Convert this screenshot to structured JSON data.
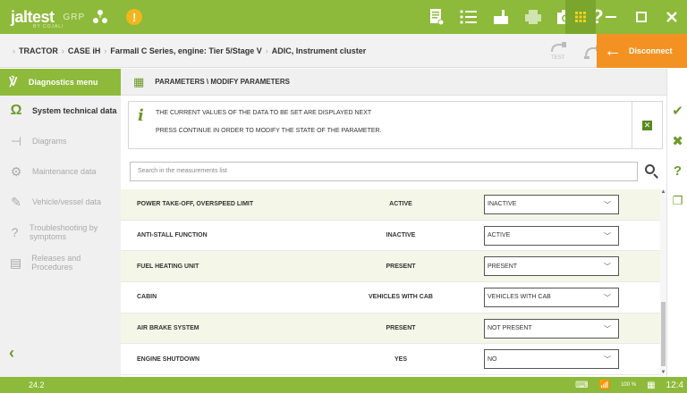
{
  "header": {
    "brand": "jaltest",
    "group": "GRP",
    "subtitle": "BY COJALI",
    "alert_symbol": "!"
  },
  "breadcrumb": [
    "TRACTOR",
    "CASE iH",
    "Farmall C Series, engine: Tier 5/Stage V",
    "ADIC, Instrument cluster"
  ],
  "breadcrumb_icons": {
    "test": "TEST"
  },
  "disconnect_label": "Disconnect",
  "sidebar": {
    "header_label": "Diagnostics menu",
    "items": [
      {
        "label": "System technical data",
        "icon": "omega-icon",
        "active": true
      },
      {
        "label": "Diagrams",
        "icon": "diagram-icon",
        "active": false
      },
      {
        "label": "Maintenance data",
        "icon": "maintenance-icon",
        "active": false
      },
      {
        "label": "Vehicle/vessel data",
        "icon": "vehicle-data-icon",
        "active": false
      },
      {
        "label": "Troubleshooting by symptoms",
        "icon": "troubleshooting-icon",
        "active": false
      },
      {
        "label": "Releases and Procedures",
        "icon": "releases-icon",
        "active": false
      }
    ]
  },
  "main": {
    "title": "PARAMETERS \\ MODIFY PARAMETERS",
    "info_line1": "THE CURRENT VALUES OF THE DATA TO BE SET ARE DISPLAYED NEXT",
    "info_line2": "PRESS CONTINUE IN ORDER TO MODIFY THE STATE OF THE PARAMETER.",
    "search_placeholder": "Search in the measurements list",
    "rows": [
      {
        "name": "POWER TAKE-OFF, OVERSPEED LIMIT",
        "current": "ACTIVE",
        "new_value": "INACTIVE"
      },
      {
        "name": "ANTI-STALL FUNCTION",
        "current": "INACTIVE",
        "new_value": "ACTIVE"
      },
      {
        "name": "FUEL HEATING UNIT",
        "current": "PRESENT",
        "new_value": "PRESENT"
      },
      {
        "name": "CABIN",
        "current": "VEHICLES WITH CAB",
        "new_value": "VEHICLES WITH CAB"
      },
      {
        "name": "AIR BRAKE SYSTEM",
        "current": "PRESENT",
        "new_value": "NOT PRESENT"
      },
      {
        "name": "ENGINE SHUTDOWN",
        "current": "YES",
        "new_value": "NO"
      }
    ]
  },
  "statusbar": {
    "version": "24.2",
    "zoom": "100 %",
    "time": "12:4"
  },
  "colors": {
    "accent_green": "#8dba3a",
    "dark_green": "#6d9a2a",
    "disconnect_orange": "#f39222",
    "alert_yellow": "#f2b51e"
  }
}
